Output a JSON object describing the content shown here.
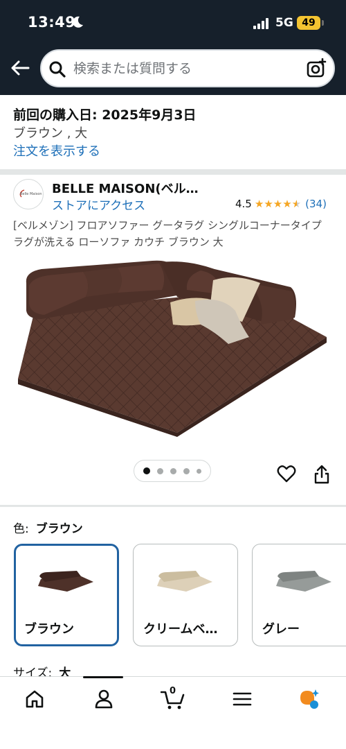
{
  "status_bar": {
    "time": "13:49",
    "network": "5G",
    "battery": "49"
  },
  "search": {
    "placeholder": "検索または質問する"
  },
  "order_info": {
    "date_line": "前回の購入日: 2025年9月3日",
    "variant": "ブラウン , 大",
    "link": "注文を表示する"
  },
  "brand": {
    "name": "BELLE MAISON(ベル…",
    "store_link": "ストアにアクセス",
    "logo_text": "Belle Maison"
  },
  "rating": {
    "value": "4.5",
    "stars": 4.5,
    "count": "(34)"
  },
  "product": {
    "title": "[ベルメゾン] フロアソファー グータラグ シングルコーナータイプ ラグが洗える ローソファ カウチ ブラウン 大",
    "image_count": 5,
    "active_image": 1
  },
  "color": {
    "label": "色:",
    "selected": "ブラウン",
    "options": [
      {
        "label": "ブラウン",
        "color": "#4e3129"
      },
      {
        "label": "クリームベ…",
        "color": "#d8cbb4"
      },
      {
        "label": "グレー",
        "color": "#8d9290"
      }
    ]
  },
  "size": {
    "label": "サイズ:",
    "selected": "大"
  },
  "bottom_nav": {
    "items": [
      "home-icon",
      "account-icon",
      "cart-icon",
      "menu-icon",
      "rufus-icon"
    ],
    "cart_count": "0"
  },
  "colors": {
    "header_bg": "#16202b",
    "link": "#1d6fb8",
    "star": "#f5a623",
    "selected_border": "#2162a1"
  }
}
